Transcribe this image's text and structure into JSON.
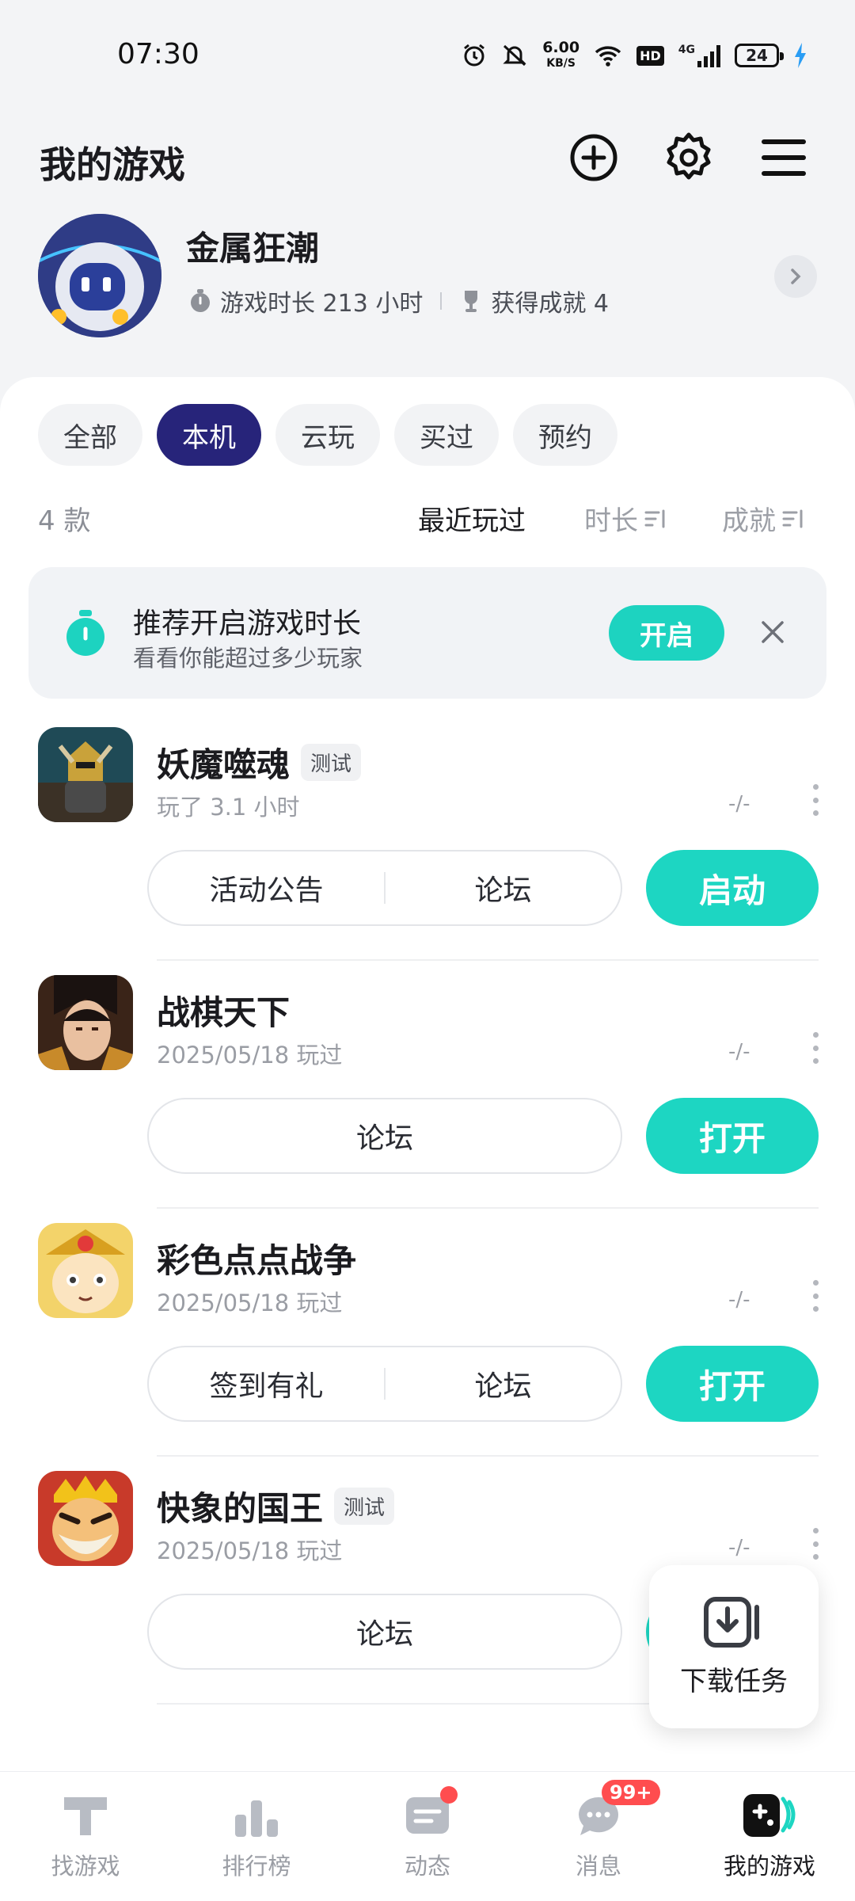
{
  "status_bar": {
    "time": "07:30",
    "net_speed_value": "6.00",
    "net_speed_unit": "KB/S",
    "hd_label": "HD",
    "network_type": "4G",
    "battery": "24"
  },
  "header": {
    "title": "我的游戏",
    "icons": [
      "add-icon",
      "settings-icon",
      "menu-icon"
    ]
  },
  "profile": {
    "name": "金属狂潮",
    "play_time": "游戏时长 213 小时",
    "achievements": "获得成就 4"
  },
  "tabs": [
    {
      "label": "全部",
      "active": false
    },
    {
      "label": "本机",
      "active": true
    },
    {
      "label": "云玩",
      "active": false
    },
    {
      "label": "买过",
      "active": false
    },
    {
      "label": "预约",
      "active": false
    }
  ],
  "list_meta": {
    "count": "4 款",
    "sort_recent": "最近玩过",
    "sort_duration": "时长",
    "sort_achievement": "成就"
  },
  "banner": {
    "title": "推荐开启游戏时长",
    "subtitle": "看看你能超过多少玩家",
    "button": "开启"
  },
  "games": [
    {
      "name": "妖魔噬魂",
      "tag": "测试",
      "sub": "玩了 3.1 小时",
      "rank": "-/-",
      "actions": [
        "活动公告",
        "论坛"
      ],
      "primary": "启动"
    },
    {
      "name": "战棋天下",
      "tag": "",
      "sub": "2025/05/18 玩过",
      "rank": "-/-",
      "actions": [
        "论坛"
      ],
      "primary": "打开"
    },
    {
      "name": "彩色点点战争",
      "tag": "",
      "sub": "2025/05/18 玩过",
      "rank": "-/-",
      "actions": [
        "签到有礼",
        "论坛"
      ],
      "primary": "打开"
    },
    {
      "name": "快象的国王",
      "tag": "测试",
      "sub": "2025/05/18 玩过",
      "rank": "-/-",
      "actions": [
        "论坛"
      ],
      "primary": ""
    }
  ],
  "download_float": {
    "label": "下载任务"
  },
  "bottom_nav": [
    {
      "label": "找游戏",
      "icon": "find-game-icon",
      "active": false
    },
    {
      "label": "排行榜",
      "icon": "ranking-icon",
      "active": false
    },
    {
      "label": "动态",
      "icon": "feed-icon",
      "active": false,
      "dot": true
    },
    {
      "label": "消息",
      "icon": "message-icon",
      "active": false,
      "badge": "99+"
    },
    {
      "label": "我的游戏",
      "icon": "my-games-icon",
      "active": true
    }
  ],
  "colors": {
    "accent": "#1dd6c2",
    "tab_active": "#27247a",
    "badge": "#ff4d4f"
  }
}
